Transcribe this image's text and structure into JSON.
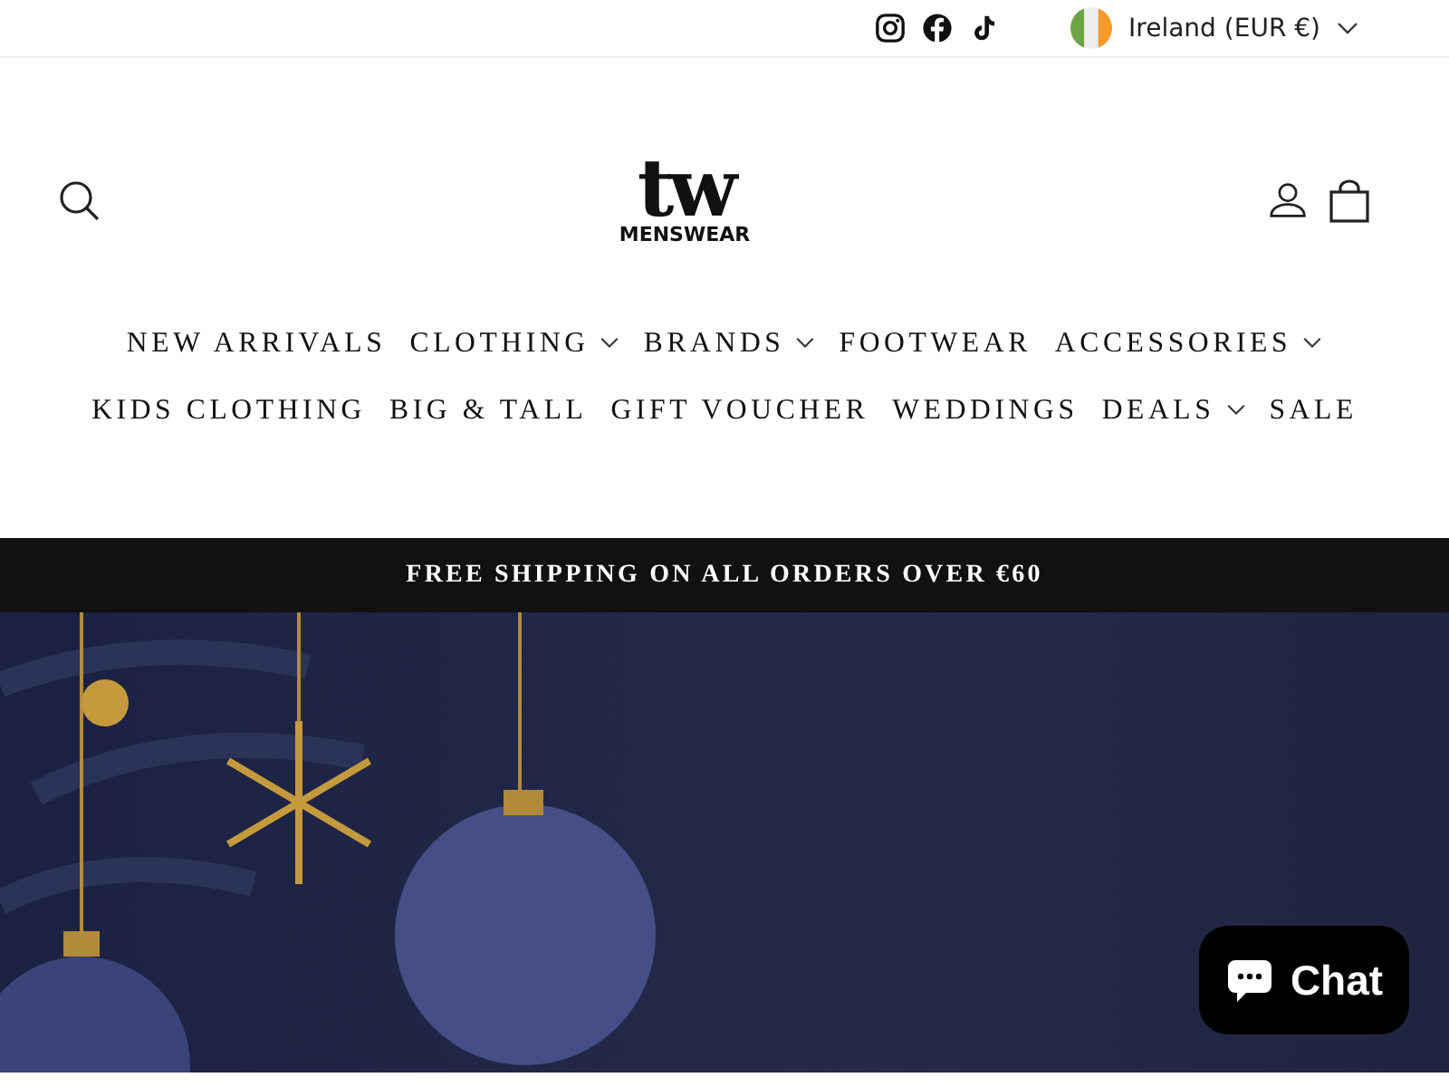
{
  "top_bar": {
    "country": "Ireland (EUR €)"
  },
  "logo": {
    "mark": "tw",
    "subtitle": "MENSWEAR"
  },
  "nav": [
    {
      "label": "NEW ARRIVALS",
      "dropdown": false
    },
    {
      "label": "CLOTHING",
      "dropdown": true
    },
    {
      "label": "BRANDS",
      "dropdown": true
    },
    {
      "label": "FOOTWEAR",
      "dropdown": false
    },
    {
      "label": "ACCESSORIES",
      "dropdown": true
    },
    {
      "label": "KIDS CLOTHING",
      "dropdown": false
    },
    {
      "label": "BIG & TALL",
      "dropdown": false
    },
    {
      "label": "GIFT VOUCHER",
      "dropdown": false
    },
    {
      "label": "WEDDINGS",
      "dropdown": false
    },
    {
      "label": "DEALS",
      "dropdown": true
    },
    {
      "label": "SALE",
      "dropdown": false
    }
  ],
  "announcement": "FREE SHIPPING ON ALL ORDERS OVER €60",
  "chat_button": {
    "label": "Chat"
  }
}
